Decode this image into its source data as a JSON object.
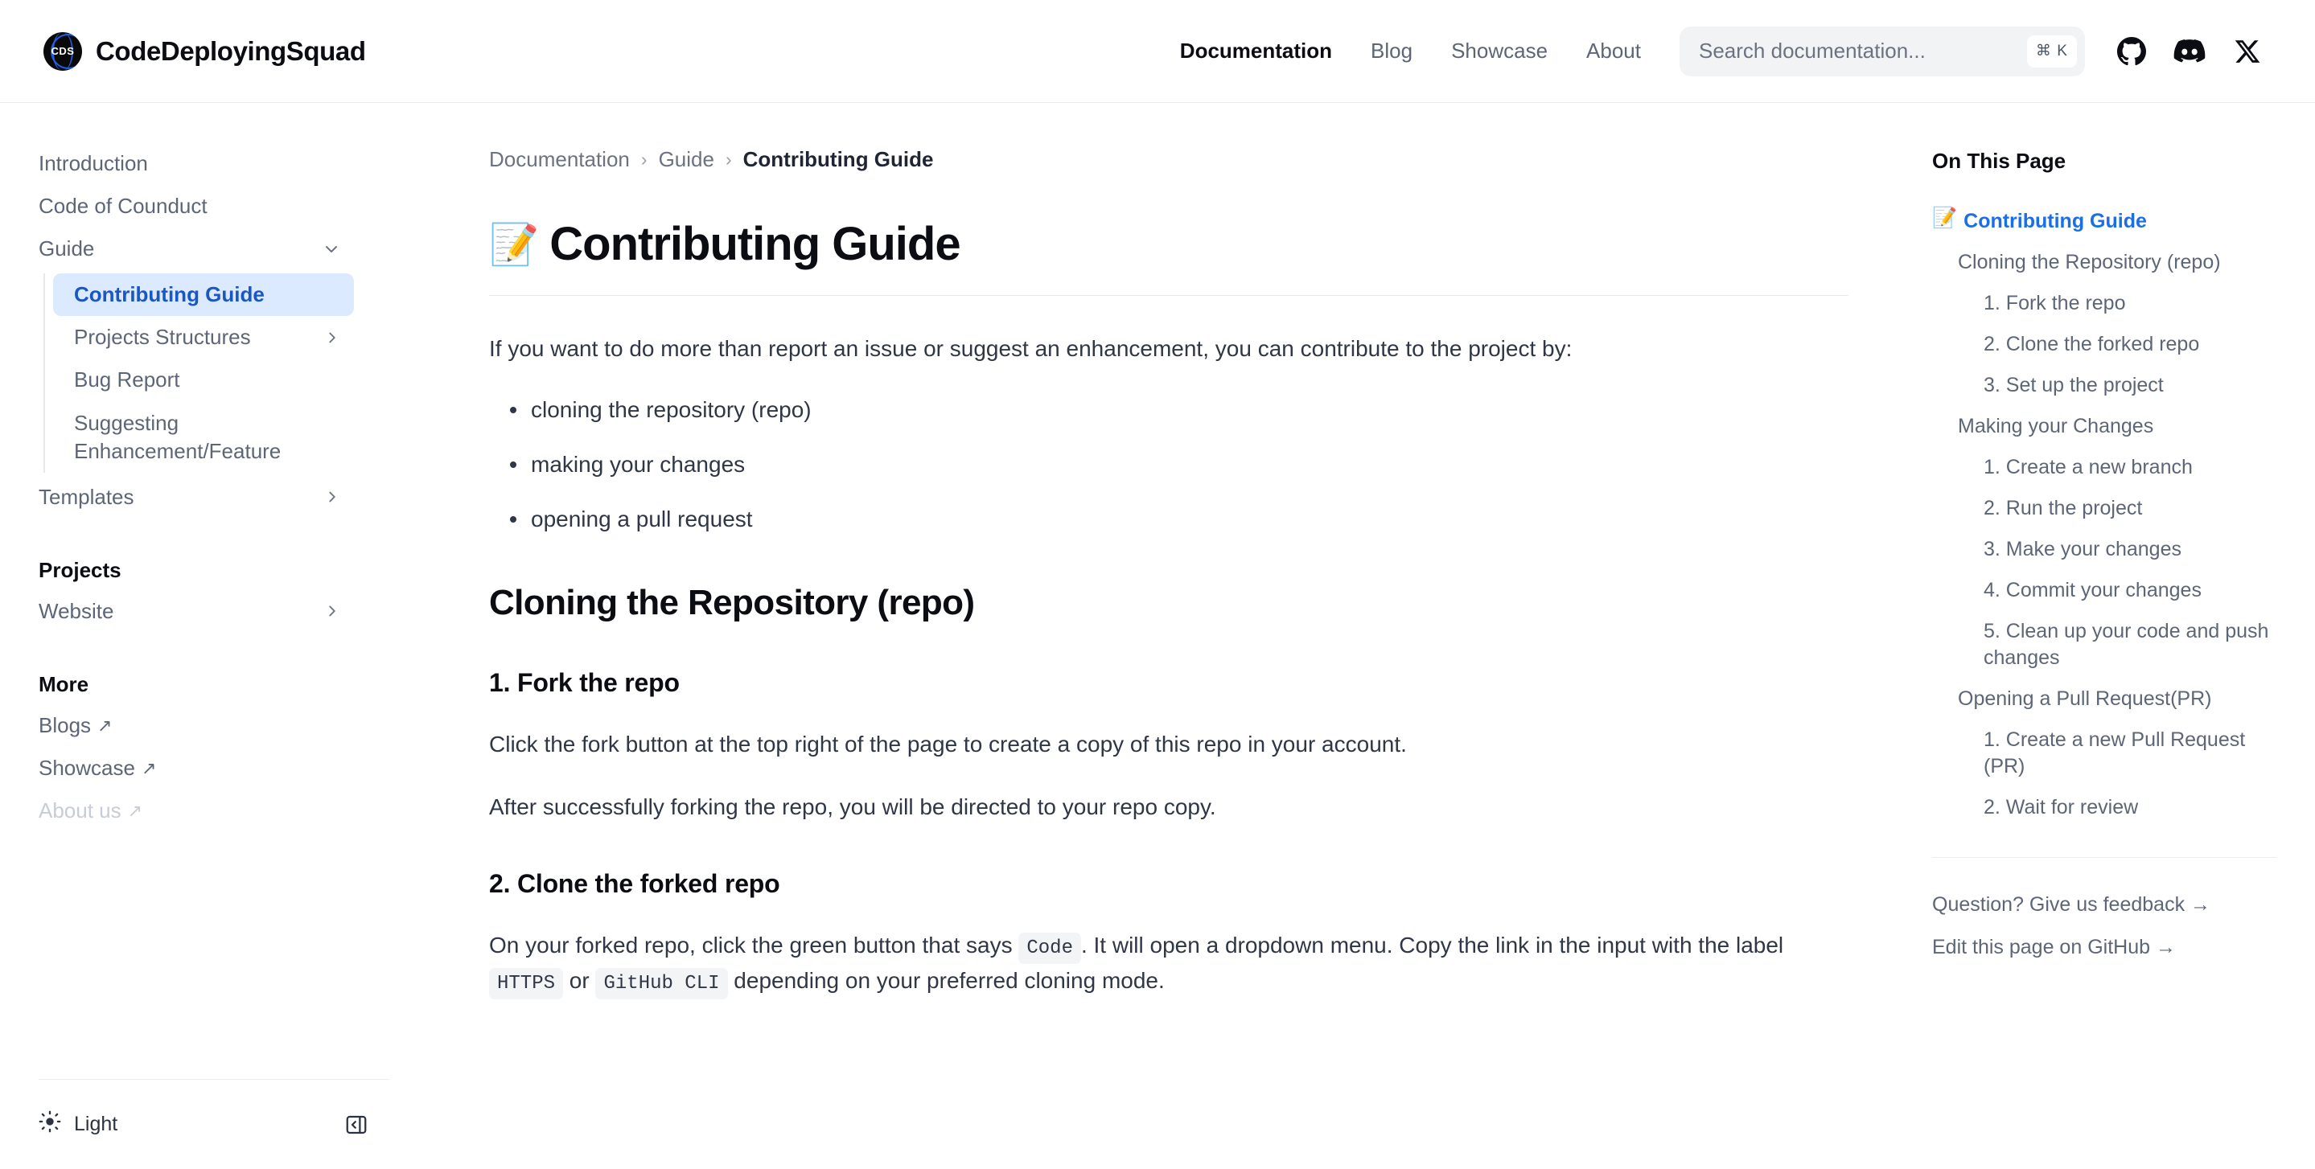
{
  "header": {
    "brand_mark": "CDS",
    "brand_name": "CodeDeployingSquad",
    "nav": [
      {
        "label": "Documentation",
        "active": true
      },
      {
        "label": "Blog",
        "active": false
      },
      {
        "label": "Showcase",
        "active": false
      },
      {
        "label": "About",
        "active": false
      }
    ],
    "search": {
      "placeholder": "Search documentation...",
      "shortcut": "⌘ K"
    },
    "social": [
      {
        "name": "github-icon",
        "label": "GitHub"
      },
      {
        "name": "discord-icon",
        "label": "Discord"
      },
      {
        "name": "x-icon",
        "label": "X"
      }
    ]
  },
  "sidebar": {
    "items": [
      {
        "label": "Introduction",
        "chevron": "none"
      },
      {
        "label": "Code of Counduct",
        "chevron": "none"
      },
      {
        "label": "Guide",
        "chevron": "down"
      }
    ],
    "guide_children": [
      {
        "label": "Contributing Guide",
        "chevron": "none",
        "active": true
      },
      {
        "label": "Projects Structures",
        "chevron": "right",
        "active": false
      },
      {
        "label": "Bug Report",
        "chevron": "none",
        "active": false
      },
      {
        "label": "Suggesting Enhancement/Feature",
        "chevron": "none",
        "active": false
      }
    ],
    "after_guide": [
      {
        "label": "Templates",
        "chevron": "right"
      }
    ],
    "projects_title": "Projects",
    "projects": [
      {
        "label": "Website",
        "chevron": "right"
      }
    ],
    "more_title": "More",
    "more": [
      {
        "label": "Blogs",
        "external": "↗",
        "faded": false
      },
      {
        "label": "Showcase",
        "external": "↗",
        "faded": false
      },
      {
        "label": "About us",
        "external": "↗",
        "faded": true
      }
    ],
    "theme": {
      "label": "Light",
      "icon": "sun-icon"
    },
    "collapse": {
      "icon": "sidebar-collapse-icon"
    }
  },
  "main": {
    "breadcrumb": [
      {
        "label": "Documentation",
        "current": false
      },
      {
        "label": "Guide",
        "current": false
      },
      {
        "label": "Contributing Guide",
        "current": true
      }
    ],
    "breadcrumb_sep": "›",
    "title_emoji": "📝",
    "title": "Contributing Guide",
    "intro": "If you want to do more than report an issue or suggest an enhancement, you can contribute to the project by:",
    "bullets": [
      "cloning the repository (repo)",
      "making your changes",
      "opening a pull request"
    ],
    "section1_heading": "Cloning the Repository (repo)",
    "step1_heading": "1. Fork the repo",
    "step1_p1": "Click the fork button at the top right of the page to create a copy of this repo in your account.",
    "step1_p2": "After successfully forking the repo, you will be directed to your repo copy.",
    "step2_heading": "2. Clone the forked repo",
    "step2_p_part1": "On your forked repo, click the green button that says ",
    "step2_code1": "Code",
    "step2_p_part2": ". It will open a dropdown menu. Copy the link in the input with the label ",
    "step2_code2": "HTTPS",
    "step2_p_part3": " or ",
    "step2_code3": "GitHub CLI",
    "step2_p_part4": " depending on your preferred cloning mode."
  },
  "toc": {
    "title": "On This Page",
    "items": [
      {
        "label": "Contributing Guide",
        "level": 1,
        "emoji": "📝"
      },
      {
        "label": "Cloning the Repository (repo)",
        "level": 2
      },
      {
        "label": "1. Fork the repo",
        "level": 3
      },
      {
        "label": "2. Clone the forked repo",
        "level": 3
      },
      {
        "label": "3. Set up the project",
        "level": 3
      },
      {
        "label": "Making your Changes",
        "level": 2
      },
      {
        "label": "1. Create a new branch",
        "level": 3
      },
      {
        "label": "2. Run the project",
        "level": 3
      },
      {
        "label": "3. Make your changes",
        "level": 3
      },
      {
        "label": "4. Commit your changes",
        "level": 3
      },
      {
        "label": "5. Clean up your code and push changes",
        "level": 3
      },
      {
        "label": "Opening a Pull Request(PR)",
        "level": 2
      },
      {
        "label": "1. Create a new Pull Request (PR)",
        "level": 3
      },
      {
        "label": "2. Wait for review",
        "level": 3
      }
    ],
    "links": [
      {
        "label": "Question? Give us feedback →"
      },
      {
        "label": "Edit this page on GitHub →"
      }
    ]
  },
  "colors": {
    "accent_blue": "#1a6fe8",
    "active_bg": "#dbeafe",
    "active_text": "#1a56c4",
    "text_primary": "#0b0d13",
    "text_secondary": "#5d6677",
    "border": "#e7e9ee"
  }
}
